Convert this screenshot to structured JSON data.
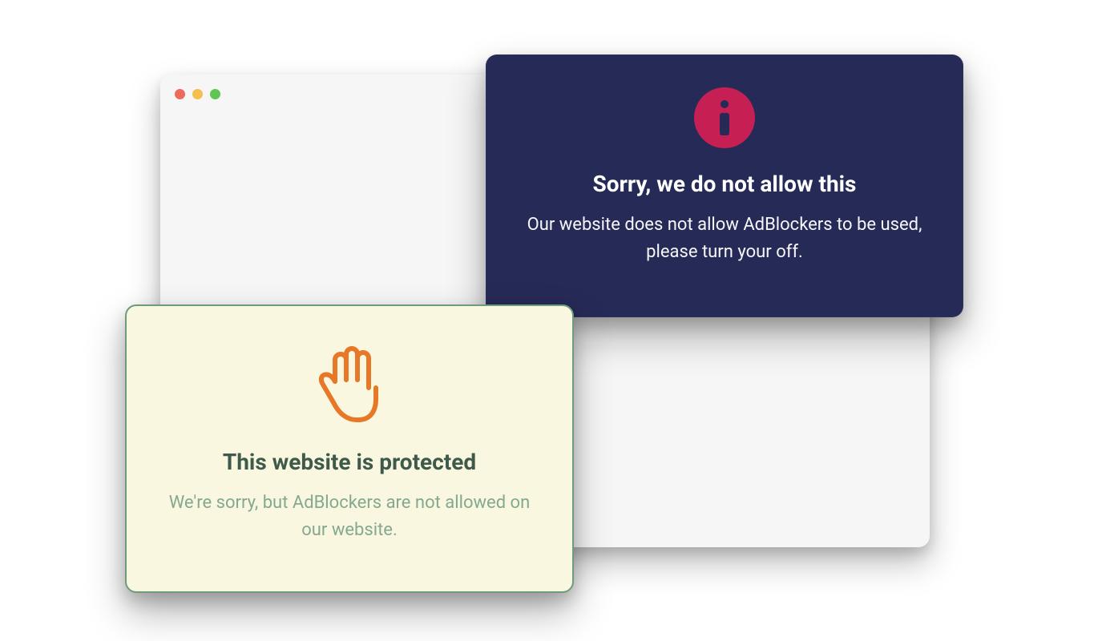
{
  "browser": {
    "traffic_light_colors": [
      "#ed6a5e",
      "#f5bf4f",
      "#61c554"
    ]
  },
  "dark_card": {
    "info_badge_color": "#c51f53",
    "title": "Sorry, we do not allow this",
    "message": "Our website does not allow AdBlockers to be used, please turn your off."
  },
  "light_card": {
    "icon_color": "#e77828",
    "title": "This website is protected",
    "message": "We're sorry, but AdBlockers are not allowed on our website."
  }
}
